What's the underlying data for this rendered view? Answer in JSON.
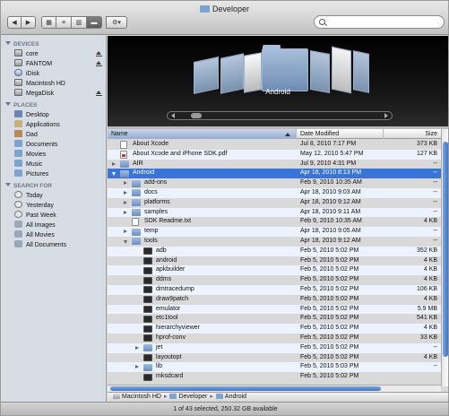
{
  "window": {
    "title": "Developer"
  },
  "toolbar": {
    "back_icon": "back-arrow-icon",
    "forward_icon": "forward-arrow-icon",
    "views": [
      "icon-view",
      "list-view",
      "column-view",
      "coverflow-view"
    ],
    "selected_view": "coverflow-view",
    "action_icon": "gear-icon",
    "search": {
      "placeholder": "",
      "value": ""
    }
  },
  "sidebar": {
    "devices_header": "DEVICES",
    "devices": [
      {
        "label": "core",
        "icon": "disk-icon",
        "eject": true
      },
      {
        "label": "FANTOM",
        "icon": "disk-icon",
        "eject": true
      },
      {
        "label": "iDisk",
        "icon": "idisk-icon",
        "eject": false
      },
      {
        "label": "Macintosh HD",
        "icon": "disk-icon",
        "eject": false
      },
      {
        "label": "MegaDisk",
        "icon": "disk-icon",
        "eject": true
      }
    ],
    "places_header": "PLACES",
    "places": [
      {
        "label": "Desktop",
        "icon": "desktop-icon"
      },
      {
        "label": "Applications",
        "icon": "applications-icon"
      },
      {
        "label": "Dad",
        "icon": "home-icon"
      },
      {
        "label": "Documents",
        "icon": "folder-icon"
      },
      {
        "label": "Movies",
        "icon": "folder-icon"
      },
      {
        "label": "Music",
        "icon": "folder-icon"
      },
      {
        "label": "Pictures",
        "icon": "folder-icon"
      }
    ],
    "search_header": "SEARCH FOR",
    "searches": [
      {
        "label": "Today",
        "icon": "clock-icon"
      },
      {
        "label": "Yesterday",
        "icon": "clock-icon"
      },
      {
        "label": "Past Week",
        "icon": "clock-icon"
      },
      {
        "label": "All Images",
        "icon": "smart-folder-icon"
      },
      {
        "label": "All Movies",
        "icon": "smart-folder-icon"
      },
      {
        "label": "All Documents",
        "icon": "smart-folder-icon"
      }
    ]
  },
  "coverflow": {
    "label": "Android"
  },
  "list": {
    "columns": {
      "name": "Name",
      "date": "Date Modified",
      "size": "Size"
    },
    "rows": [
      {
        "name": "About Xcode",
        "date": "Jul 8, 2010 7:17 PM",
        "size": "373 KB",
        "icon": "document-icon",
        "indent": 0,
        "disclosure": ""
      },
      {
        "name": "About Xcode and iPhone SDK.pdf",
        "date": "May 12, 2010 5:47 PM",
        "size": "127 KB",
        "icon": "pdf-icon",
        "indent": 0,
        "disclosure": ""
      },
      {
        "name": "AIR",
        "date": "Jul 9, 2010 4:31 PM",
        "size": "--",
        "icon": "folder-icon",
        "indent": 0,
        "disclosure": "closed"
      },
      {
        "name": "Android",
        "date": "Apr 18, 2010 8:13 PM",
        "size": "--",
        "icon": "folder-icon",
        "indent": 0,
        "disclosure": "open",
        "selected": true
      },
      {
        "name": "add-ons",
        "date": "Feb 9, 2010 10:35 AM",
        "size": "--",
        "icon": "folder-icon",
        "indent": 1,
        "disclosure": "closed"
      },
      {
        "name": "docs",
        "date": "Apr 18, 2010 9:03 AM",
        "size": "--",
        "icon": "folder-icon",
        "indent": 1,
        "disclosure": "closed"
      },
      {
        "name": "platforms",
        "date": "Apr 18, 2010 9:12 AM",
        "size": "--",
        "icon": "folder-icon",
        "indent": 1,
        "disclosure": "closed"
      },
      {
        "name": "samples",
        "date": "Apr 18, 2010 9:11 AM",
        "size": "--",
        "icon": "folder-icon",
        "indent": 1,
        "disclosure": "closed"
      },
      {
        "name": "SDK Readme.txt",
        "date": "Feb 9, 2010 10:35 AM",
        "size": "4 KB",
        "icon": "document-icon",
        "indent": 1,
        "disclosure": ""
      },
      {
        "name": "temp",
        "date": "Apr 18, 2010 9:05 AM",
        "size": "--",
        "icon": "folder-icon",
        "indent": 1,
        "disclosure": "closed"
      },
      {
        "name": "tools",
        "date": "Apr 18, 2010 9:12 AM",
        "size": "--",
        "icon": "folder-icon",
        "indent": 1,
        "disclosure": "open"
      },
      {
        "name": "adb",
        "date": "Feb 5, 2010 5:02 PM",
        "size": "352 KB",
        "icon": "executable-icon",
        "indent": 2,
        "disclosure": ""
      },
      {
        "name": "android",
        "date": "Feb 5, 2010 5:02 PM",
        "size": "4 KB",
        "icon": "executable-icon",
        "indent": 2,
        "disclosure": ""
      },
      {
        "name": "apkbuilder",
        "date": "Feb 5, 2010 5:02 PM",
        "size": "4 KB",
        "icon": "executable-icon",
        "indent": 2,
        "disclosure": ""
      },
      {
        "name": "ddms",
        "date": "Feb 5, 2010 5:02 PM",
        "size": "4 KB",
        "icon": "executable-icon",
        "indent": 2,
        "disclosure": ""
      },
      {
        "name": "dmtracedump",
        "date": "Feb 5, 2010 5:02 PM",
        "size": "106 KB",
        "icon": "executable-icon",
        "indent": 2,
        "disclosure": ""
      },
      {
        "name": "draw9patch",
        "date": "Feb 5, 2010 5:02 PM",
        "size": "4 KB",
        "icon": "executable-icon",
        "indent": 2,
        "disclosure": ""
      },
      {
        "name": "emulator",
        "date": "Feb 5, 2010 5:02 PM",
        "size": "5.9 MB",
        "icon": "executable-icon",
        "indent": 2,
        "disclosure": ""
      },
      {
        "name": "etc1tool",
        "date": "Feb 5, 2010 5:02 PM",
        "size": "541 KB",
        "icon": "executable-icon",
        "indent": 2,
        "disclosure": ""
      },
      {
        "name": "hierarchyviewer",
        "date": "Feb 5, 2010 5:02 PM",
        "size": "4 KB",
        "icon": "executable-icon",
        "indent": 2,
        "disclosure": ""
      },
      {
        "name": "hprof-conv",
        "date": "Feb 5, 2010 5:02 PM",
        "size": "33 KB",
        "icon": "executable-icon",
        "indent": 2,
        "disclosure": ""
      },
      {
        "name": "jet",
        "date": "Feb 5, 2010 5:02 PM",
        "size": "--",
        "icon": "folder-icon",
        "indent": 2,
        "disclosure": "closed"
      },
      {
        "name": "layoutopt",
        "date": "Feb 5, 2010 5:02 PM",
        "size": "4 KB",
        "icon": "executable-icon",
        "indent": 2,
        "disclosure": ""
      },
      {
        "name": "lib",
        "date": "Feb 5, 2010 5:03 PM",
        "size": "--",
        "icon": "folder-icon",
        "indent": 2,
        "disclosure": "closed"
      },
      {
        "name": "mksdcard",
        "date": "Feb 5, 2010 5:02 PM",
        "size": "",
        "icon": "executable-icon",
        "indent": 2,
        "disclosure": ""
      }
    ]
  },
  "pathbar": {
    "items": [
      "Macintosh HD",
      "Developer",
      "Android"
    ]
  },
  "status": {
    "text": "1 of 43 selected, 250.32 GB available"
  }
}
